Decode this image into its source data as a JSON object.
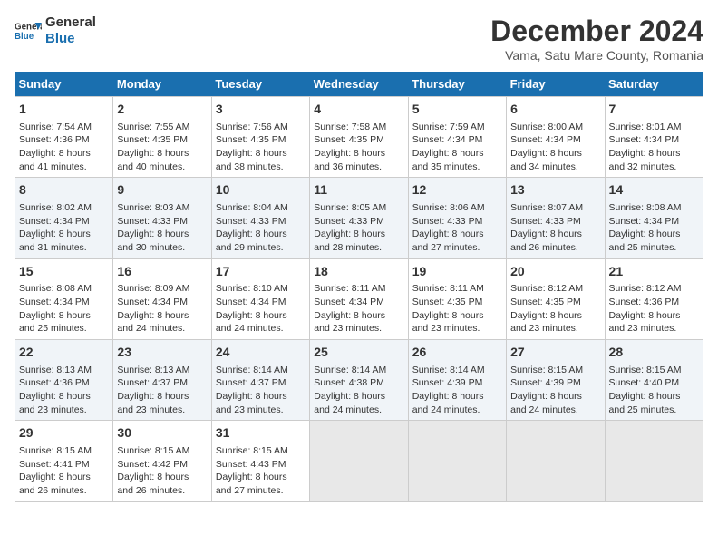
{
  "logo": {
    "line1": "General",
    "line2": "Blue"
  },
  "title": "December 2024",
  "subtitle": "Vama, Satu Mare County, Romania",
  "days_of_week": [
    "Sunday",
    "Monday",
    "Tuesday",
    "Wednesday",
    "Thursday",
    "Friday",
    "Saturday"
  ],
  "weeks": [
    [
      {
        "day": 1,
        "lines": [
          "Sunrise: 7:54 AM",
          "Sunset: 4:36 PM",
          "Daylight: 8 hours",
          "and 41 minutes."
        ]
      },
      {
        "day": 2,
        "lines": [
          "Sunrise: 7:55 AM",
          "Sunset: 4:35 PM",
          "Daylight: 8 hours",
          "and 40 minutes."
        ]
      },
      {
        "day": 3,
        "lines": [
          "Sunrise: 7:56 AM",
          "Sunset: 4:35 PM",
          "Daylight: 8 hours",
          "and 38 minutes."
        ]
      },
      {
        "day": 4,
        "lines": [
          "Sunrise: 7:58 AM",
          "Sunset: 4:35 PM",
          "Daylight: 8 hours",
          "and 36 minutes."
        ]
      },
      {
        "day": 5,
        "lines": [
          "Sunrise: 7:59 AM",
          "Sunset: 4:34 PM",
          "Daylight: 8 hours",
          "and 35 minutes."
        ]
      },
      {
        "day": 6,
        "lines": [
          "Sunrise: 8:00 AM",
          "Sunset: 4:34 PM",
          "Daylight: 8 hours",
          "and 34 minutes."
        ]
      },
      {
        "day": 7,
        "lines": [
          "Sunrise: 8:01 AM",
          "Sunset: 4:34 PM",
          "Daylight: 8 hours",
          "and 32 minutes."
        ]
      }
    ],
    [
      {
        "day": 8,
        "lines": [
          "Sunrise: 8:02 AM",
          "Sunset: 4:34 PM",
          "Daylight: 8 hours",
          "and 31 minutes."
        ]
      },
      {
        "day": 9,
        "lines": [
          "Sunrise: 8:03 AM",
          "Sunset: 4:33 PM",
          "Daylight: 8 hours",
          "and 30 minutes."
        ]
      },
      {
        "day": 10,
        "lines": [
          "Sunrise: 8:04 AM",
          "Sunset: 4:33 PM",
          "Daylight: 8 hours",
          "and 29 minutes."
        ]
      },
      {
        "day": 11,
        "lines": [
          "Sunrise: 8:05 AM",
          "Sunset: 4:33 PM",
          "Daylight: 8 hours",
          "and 28 minutes."
        ]
      },
      {
        "day": 12,
        "lines": [
          "Sunrise: 8:06 AM",
          "Sunset: 4:33 PM",
          "Daylight: 8 hours",
          "and 27 minutes."
        ]
      },
      {
        "day": 13,
        "lines": [
          "Sunrise: 8:07 AM",
          "Sunset: 4:33 PM",
          "Daylight: 8 hours",
          "and 26 minutes."
        ]
      },
      {
        "day": 14,
        "lines": [
          "Sunrise: 8:08 AM",
          "Sunset: 4:34 PM",
          "Daylight: 8 hours",
          "and 25 minutes."
        ]
      }
    ],
    [
      {
        "day": 15,
        "lines": [
          "Sunrise: 8:08 AM",
          "Sunset: 4:34 PM",
          "Daylight: 8 hours",
          "and 25 minutes."
        ]
      },
      {
        "day": 16,
        "lines": [
          "Sunrise: 8:09 AM",
          "Sunset: 4:34 PM",
          "Daylight: 8 hours",
          "and 24 minutes."
        ]
      },
      {
        "day": 17,
        "lines": [
          "Sunrise: 8:10 AM",
          "Sunset: 4:34 PM",
          "Daylight: 8 hours",
          "and 24 minutes."
        ]
      },
      {
        "day": 18,
        "lines": [
          "Sunrise: 8:11 AM",
          "Sunset: 4:34 PM",
          "Daylight: 8 hours",
          "and 23 minutes."
        ]
      },
      {
        "day": 19,
        "lines": [
          "Sunrise: 8:11 AM",
          "Sunset: 4:35 PM",
          "Daylight: 8 hours",
          "and 23 minutes."
        ]
      },
      {
        "day": 20,
        "lines": [
          "Sunrise: 8:12 AM",
          "Sunset: 4:35 PM",
          "Daylight: 8 hours",
          "and 23 minutes."
        ]
      },
      {
        "day": 21,
        "lines": [
          "Sunrise: 8:12 AM",
          "Sunset: 4:36 PM",
          "Daylight: 8 hours",
          "and 23 minutes."
        ]
      }
    ],
    [
      {
        "day": 22,
        "lines": [
          "Sunrise: 8:13 AM",
          "Sunset: 4:36 PM",
          "Daylight: 8 hours",
          "and 23 minutes."
        ]
      },
      {
        "day": 23,
        "lines": [
          "Sunrise: 8:13 AM",
          "Sunset: 4:37 PM",
          "Daylight: 8 hours",
          "and 23 minutes."
        ]
      },
      {
        "day": 24,
        "lines": [
          "Sunrise: 8:14 AM",
          "Sunset: 4:37 PM",
          "Daylight: 8 hours",
          "and 23 minutes."
        ]
      },
      {
        "day": 25,
        "lines": [
          "Sunrise: 8:14 AM",
          "Sunset: 4:38 PM",
          "Daylight: 8 hours",
          "and 24 minutes."
        ]
      },
      {
        "day": 26,
        "lines": [
          "Sunrise: 8:14 AM",
          "Sunset: 4:39 PM",
          "Daylight: 8 hours",
          "and 24 minutes."
        ]
      },
      {
        "day": 27,
        "lines": [
          "Sunrise: 8:15 AM",
          "Sunset: 4:39 PM",
          "Daylight: 8 hours",
          "and 24 minutes."
        ]
      },
      {
        "day": 28,
        "lines": [
          "Sunrise: 8:15 AM",
          "Sunset: 4:40 PM",
          "Daylight: 8 hours",
          "and 25 minutes."
        ]
      }
    ],
    [
      {
        "day": 29,
        "lines": [
          "Sunrise: 8:15 AM",
          "Sunset: 4:41 PM",
          "Daylight: 8 hours",
          "and 26 minutes."
        ]
      },
      {
        "day": 30,
        "lines": [
          "Sunrise: 8:15 AM",
          "Sunset: 4:42 PM",
          "Daylight: 8 hours",
          "and 26 minutes."
        ]
      },
      {
        "day": 31,
        "lines": [
          "Sunrise: 8:15 AM",
          "Sunset: 4:43 PM",
          "Daylight: 8 hours",
          "and 27 minutes."
        ]
      },
      null,
      null,
      null,
      null
    ]
  ]
}
